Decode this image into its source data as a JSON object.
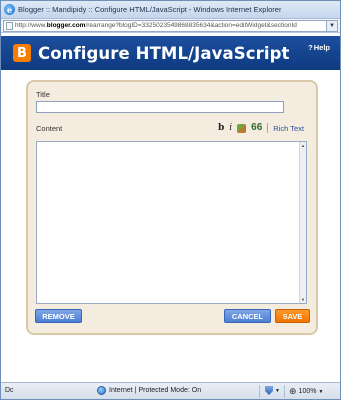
{
  "window": {
    "title": "Blogger :: Mandipidy :: Configure HTML/JavaScript - Windows Internet Explorer",
    "url_prefix": "http://www.",
    "url_domain": "blogger.com",
    "url_rest": "/rearrange?blogID=3325023549868835634&action=editWidget&sectionId"
  },
  "dialog": {
    "title": "Configure HTML/JavaScript",
    "help_label": "Help"
  },
  "form": {
    "title_label": "Title",
    "title_value": "",
    "content_label": "Content",
    "content_value": "",
    "toolbar": {
      "bold": "b",
      "italic": "i",
      "quote": "66",
      "rich_text": "Rich Text"
    }
  },
  "buttons": {
    "remove": "REMOVE",
    "cancel": "CANCEL",
    "save": "SAVE"
  },
  "statusbar": {
    "left": "Dc",
    "zone": "Internet | Protected Mode: On",
    "zoom": "100%"
  },
  "icons": {
    "browser": "internet-explorer-icon",
    "logo": "blogger-logo-icon",
    "image": "insert-image-icon",
    "zone": "globe-icon",
    "security": "shield-icon",
    "zoom": "zoom-icon"
  },
  "colors": {
    "header_bg": "#0e3a80",
    "panel_bg": "#f4ecdf",
    "panel_border": "#d9c7a8",
    "blue_button": "#4d7fd3",
    "save_button": "#f07300",
    "link": "#2b4f9e"
  }
}
